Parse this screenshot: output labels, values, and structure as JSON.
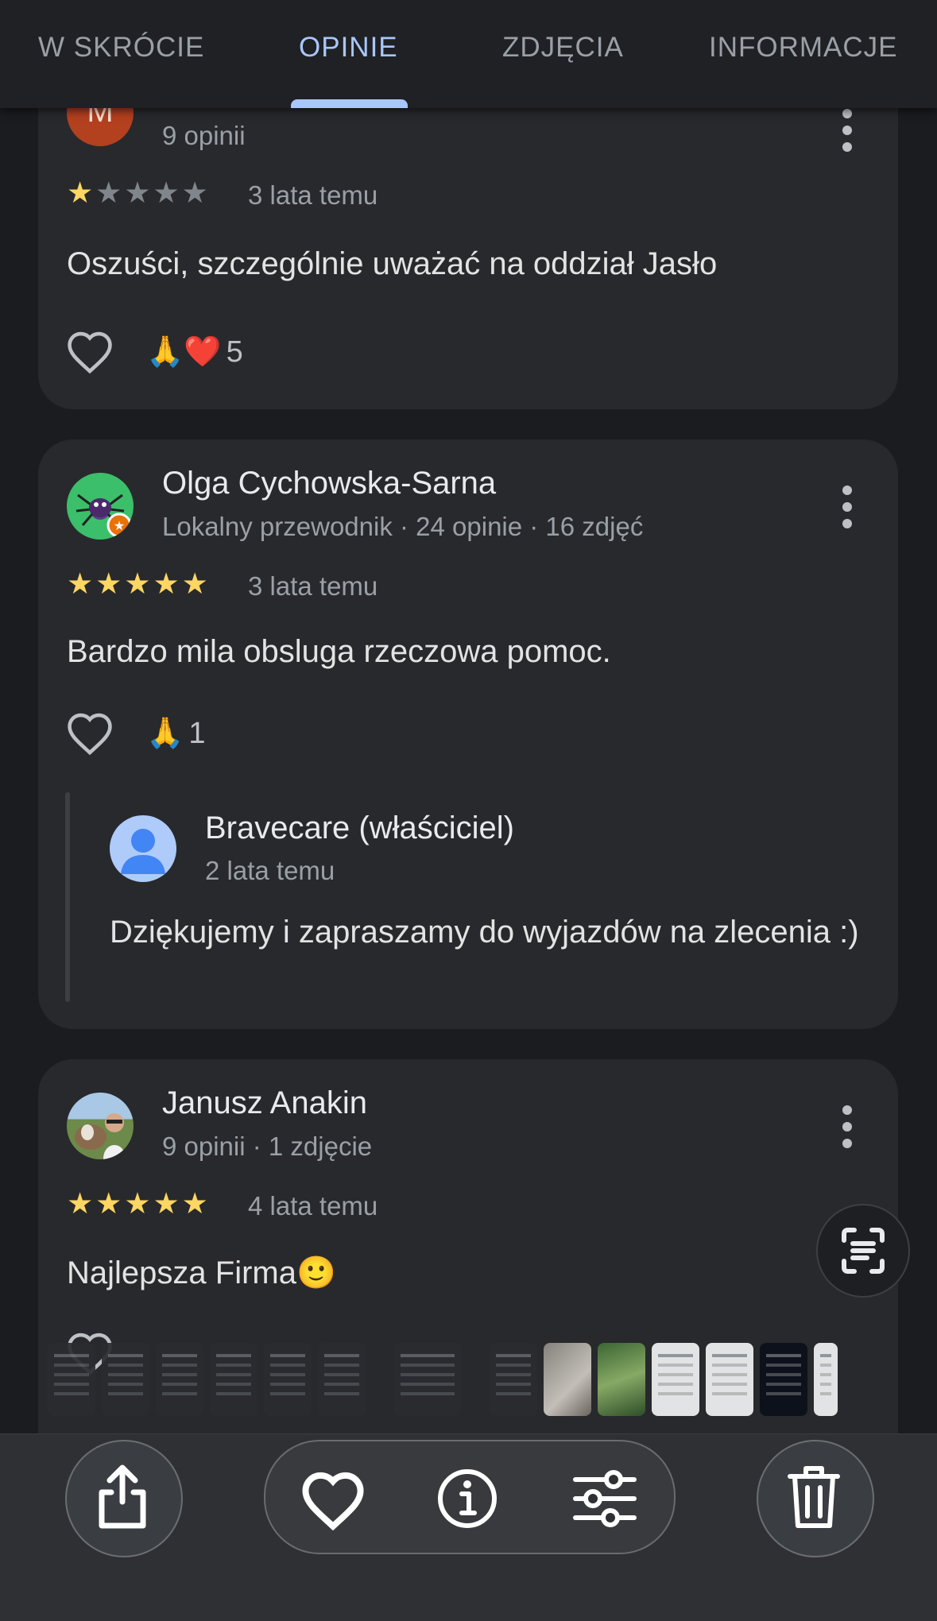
{
  "tabs": [
    {
      "label": "W SKRÓCIE",
      "active": false
    },
    {
      "label": "OPINIE",
      "active": true
    },
    {
      "label": "ZDJĘCIA",
      "active": false
    },
    {
      "label": "INFORMACJE",
      "active": false
    }
  ],
  "reviews": [
    {
      "avatar_initial": "M",
      "meta": "9 opinii",
      "stars": 1,
      "stars_text": "★",
      "stars_off_text": "★★★★",
      "date": "3 lata temu",
      "text": "Oszuści, szczególnie uważać na oddział Jasło",
      "reactions": "🙏❤️",
      "reaction_count": "5"
    },
    {
      "name": "Olga Cychowska-Sarna",
      "meta": "Lokalny przewodnik · 24 opinie · 16 zdjęć",
      "stars": 5,
      "stars_text": "★★★★★",
      "date": "3 lata temu",
      "text": "Bardzo mila obsluga rzeczowa pomoc.",
      "reactions": "🙏",
      "reaction_count": "1",
      "owner_reply": {
        "name": "Bravecare (właściciel)",
        "date": "2 lata temu",
        "text": "Dziękujemy i zapraszamy do wyjazdów na zlecenia :)"
      }
    },
    {
      "name": "Janusz Anakin",
      "meta": "9 opinii · 1 zdjęcie",
      "stars": 5,
      "stars_text": "★★★★★",
      "date": "4 lata temu",
      "text": "Najlepsza Firma🙂"
    }
  ],
  "icons": {
    "more": "more-vert-icon",
    "like": "heart-outline-icon",
    "scan": "text-scan-icon",
    "share": "share-icon",
    "favorite": "heart-icon",
    "info": "info-icon",
    "adjust": "sliders-icon",
    "delete": "trash-icon"
  },
  "colors": {
    "background": "#1b1c1f",
    "card": "#28292c",
    "accent": "#a8c7fa",
    "star": "#fdd663",
    "avatar_m": "#b3401f"
  }
}
